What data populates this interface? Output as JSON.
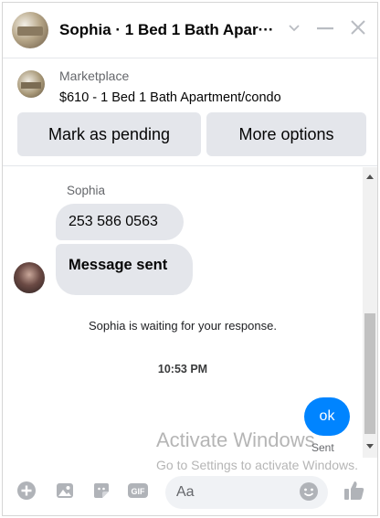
{
  "header": {
    "title": "Sophia · 1 Bed 1 Bath Apar···"
  },
  "marketplace": {
    "label": "Marketplace",
    "listing_title": "$610 - 1 Bed 1 Bath Apartment/condo",
    "mark_pending_label": "Mark as pending",
    "more_options_label": "More options"
  },
  "chat": {
    "sender_name": "Sophia",
    "messages": [
      {
        "text": "253 586 0563"
      },
      {
        "text": "Message sent"
      }
    ],
    "system_message": "Sophia is waiting for your response.",
    "timestamp": "10:53 PM",
    "outgoing": {
      "text": "ok",
      "status": "Sent"
    }
  },
  "watermark": {
    "line1": "Activate Windows",
    "line2": "Go to Settings to activate Windows."
  },
  "composer": {
    "placeholder": "Aa"
  },
  "colors": {
    "accent": "#0084ff",
    "bubble_gray": "#e4e6eb",
    "icon_gray": "#b0b3b8"
  },
  "icons": [
    "chevron-down-icon",
    "minimize-icon",
    "close-icon",
    "plus-icon",
    "image-icon",
    "sticker-icon",
    "gif-icon",
    "emoji-icon",
    "like-icon"
  ]
}
